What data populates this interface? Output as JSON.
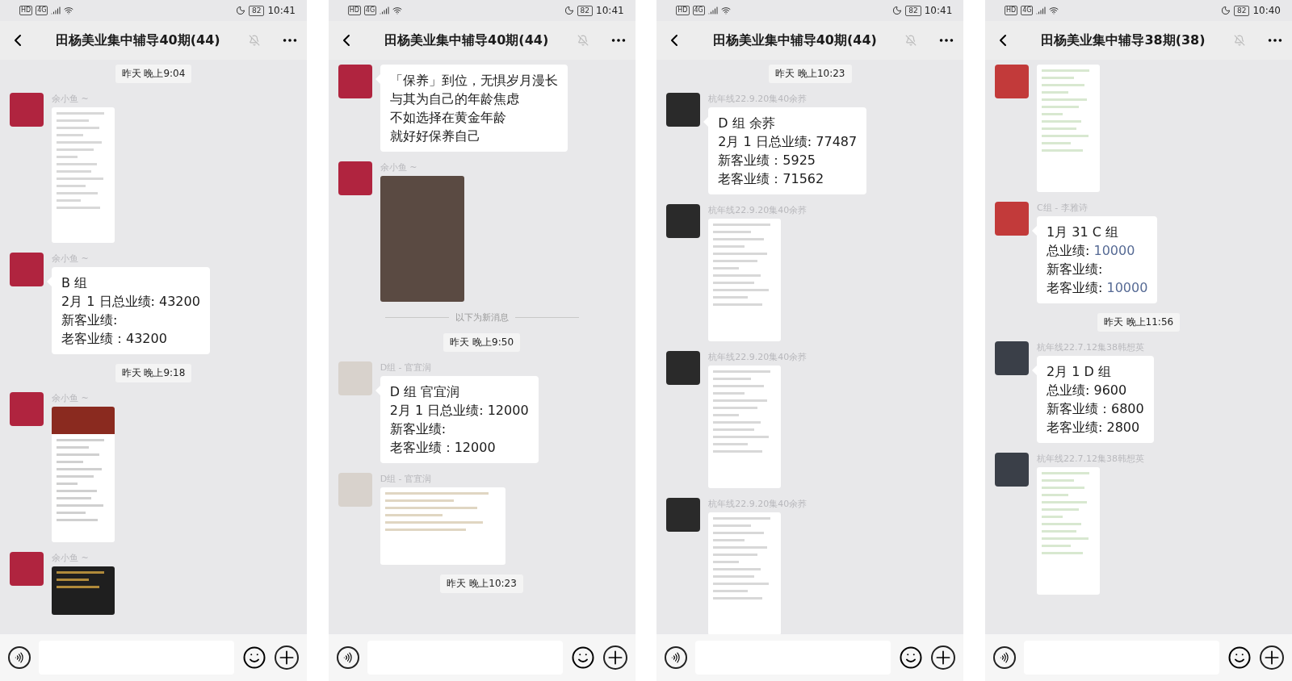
{
  "phones": [
    {
      "status": {
        "labels": [
          "HD",
          "4G"
        ],
        "battery": "82",
        "time": "10:41"
      },
      "title": "田杨美业集中辅导40期(44)",
      "muted": true,
      "messages": [
        {
          "kind": "time",
          "text": "昨天 晚上9:04"
        },
        {
          "kind": "receipt-list",
          "sender": "余小鱼 ~",
          "color": "#b0243f"
        },
        {
          "kind": "text",
          "sender": "余小鱼 ~",
          "color": "#b0243f",
          "lines": [
            {
              "text": "B 组"
            },
            {
              "text": "2月 1 日总业绩: 43200"
            },
            {
              "text": "新客业绩:"
            },
            {
              "text": "老客业绩：43200"
            }
          ]
        },
        {
          "kind": "time",
          "text": "昨天 晚上9:18"
        },
        {
          "kind": "ranking-list",
          "sender": "余小鱼 ~",
          "color": "#b0243f"
        },
        {
          "kind": "banner",
          "sender": "余小鱼 ~",
          "color": "#b0243f"
        }
      ]
    },
    {
      "status": {
        "labels": [
          "HD",
          "4G"
        ],
        "battery": "82",
        "time": "10:41"
      },
      "title": "田杨美业集中辅导40期(44)",
      "muted": true,
      "messages": [
        {
          "kind": "text",
          "color": "#b0243f",
          "lines": [
            {
              "text": "「保养」到位，无惧岁月漫长"
            },
            {
              "text": "与其为自己的年龄焦虑"
            },
            {
              "text": "不如选择在黄金年龄"
            },
            {
              "text": "就好好保养自己"
            }
          ]
        },
        {
          "kind": "photo",
          "sender": "余小鱼 ~",
          "color": "#b0243f"
        },
        {
          "kind": "divider",
          "text": "以下为新消息"
        },
        {
          "kind": "time",
          "text": "昨天 晚上9:50"
        },
        {
          "kind": "text",
          "sender": "D组 - 官宜润",
          "color": "#d8d2cc",
          "lines": [
            {
              "text": "D 组 官宜润"
            },
            {
              "text": "2月 1 日总业绩: 12000"
            },
            {
              "text": "新客业绩:"
            },
            {
              "text": "老客业绩：12000"
            }
          ]
        },
        {
          "kind": "receipt-card",
          "sender": "D组 - 官宜润",
          "color": "#d8d2cc"
        },
        {
          "kind": "time",
          "text": "昨天 晚上10:23"
        }
      ]
    },
    {
      "status": {
        "labels": [
          "HD",
          "4G"
        ],
        "battery": "82",
        "time": "10:41"
      },
      "title": "田杨美业集中辅导40期(44)",
      "muted": true,
      "messages": [
        {
          "kind": "time",
          "text": "昨天 晚上10:23"
        },
        {
          "kind": "text",
          "sender": "杭年线22.9.20集40余荞",
          "color": "#2a2a2a",
          "lines": [
            {
              "text": "D 组 余荞"
            },
            {
              "text": "2月 1 日总业绩: 77487"
            },
            {
              "text": "新客业绩：5925"
            },
            {
              "text": "老客业绩：71562"
            }
          ]
        },
        {
          "kind": "payment-list",
          "sender": "杭年线22.9.20集40余荞",
          "color": "#2a2a2a"
        },
        {
          "kind": "payment-list",
          "sender": "杭年线22.9.20集40余荞",
          "color": "#2a2a2a"
        },
        {
          "kind": "payment-list",
          "sender": "杭年线22.9.20集40余荞",
          "color": "#2a2a2a"
        }
      ]
    },
    {
      "status": {
        "labels": [
          "HD",
          "4G"
        ],
        "battery": "82",
        "time": "10:40"
      },
      "title": "田杨美业集中辅导38期(38)",
      "muted": true,
      "messages": [
        {
          "kind": "chat-screenshot",
          "color": "#c23a3a"
        },
        {
          "kind": "text",
          "sender": "C组 - 李雅诗",
          "color": "#c23a3a",
          "lines": [
            {
              "text": "1月 31 C 组"
            },
            {
              "text": "总业绩: ",
              "accent": "10000"
            },
            {
              "text": "新客业绩:"
            },
            {
              "text": "老客业绩: ",
              "accent": "10000"
            }
          ]
        },
        {
          "kind": "time",
          "text": "昨天 晚上11:56"
        },
        {
          "kind": "text",
          "sender": "杭年线22.7.12集38韩想英",
          "color": "#3a3f48",
          "lines": [
            {
              "text": "2月 1  D 组"
            },
            {
              "text": "总业绩: 9600"
            },
            {
              "text": "新客业绩：6800"
            },
            {
              "text": "老客业绩: 2800"
            }
          ]
        },
        {
          "kind": "chat-screenshot",
          "sender": "杭年线22.7.12集38韩想英",
          "color": "#3a3f48"
        }
      ]
    }
  ]
}
